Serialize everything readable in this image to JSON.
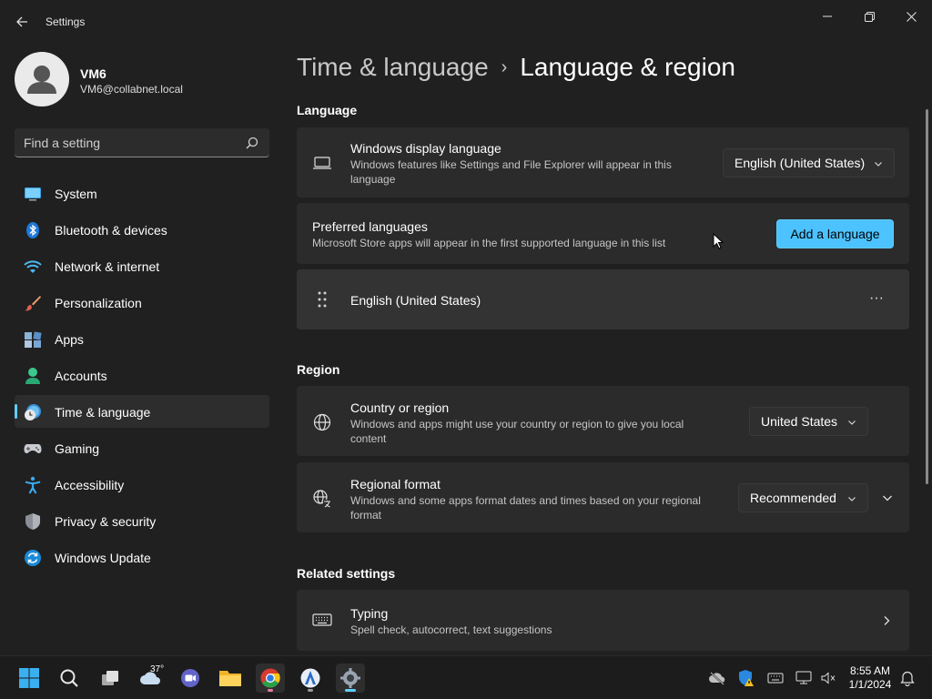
{
  "window": {
    "title": "Settings",
    "controls": [
      "minimize-icon",
      "restore-icon",
      "close-icon"
    ]
  },
  "profile": {
    "name": "VM6",
    "email": "VM6@collabnet.local"
  },
  "search": {
    "placeholder": "Find a setting"
  },
  "sidebar": {
    "items": [
      {
        "label": "System",
        "icon": "system-icon"
      },
      {
        "label": "Bluetooth & devices",
        "icon": "bluetooth-icon"
      },
      {
        "label": "Network & internet",
        "icon": "network-icon"
      },
      {
        "label": "Personalization",
        "icon": "brush-icon"
      },
      {
        "label": "Apps",
        "icon": "apps-icon"
      },
      {
        "label": "Accounts",
        "icon": "accounts-icon"
      },
      {
        "label": "Time & language",
        "icon": "time-language-icon",
        "active": true
      },
      {
        "label": "Gaming",
        "icon": "gamepad-icon"
      },
      {
        "label": "Accessibility",
        "icon": "accessibility-icon"
      },
      {
        "label": "Privacy & security",
        "icon": "shield-icon"
      },
      {
        "label": "Windows Update",
        "icon": "update-icon"
      }
    ]
  },
  "breadcrumb": {
    "parent": "Time & language",
    "separator": "›",
    "current": "Language & region"
  },
  "language_section": {
    "heading": "Language",
    "display_language": {
      "title": "Windows display language",
      "description": "Windows features like Settings and File Explorer will appear in this language",
      "value": "English (United States)"
    },
    "preferred": {
      "title": "Preferred languages",
      "description": "Microsoft Store apps will appear in the first supported language in this list",
      "button": "Add a language"
    },
    "installed": [
      {
        "name": "English (United States)",
        "more": "···"
      }
    ]
  },
  "region_section": {
    "heading": "Region",
    "country": {
      "title": "Country or region",
      "description": "Windows and apps might use your country or region to give you local content",
      "value": "United States"
    },
    "format": {
      "title": "Regional format",
      "description": "Windows and some apps format dates and times based on your regional format",
      "value": "Recommended"
    }
  },
  "related_section": {
    "heading": "Related settings",
    "typing": {
      "title": "Typing",
      "description": "Spell check, autocorrect, text suggestions"
    }
  },
  "taskbar": {
    "weather_temp": "37°",
    "time": "8:55 AM",
    "date": "1/1/2024"
  },
  "colors": {
    "accent": "#4cc2ff",
    "background": "#202020",
    "card": "#2b2b2b"
  }
}
